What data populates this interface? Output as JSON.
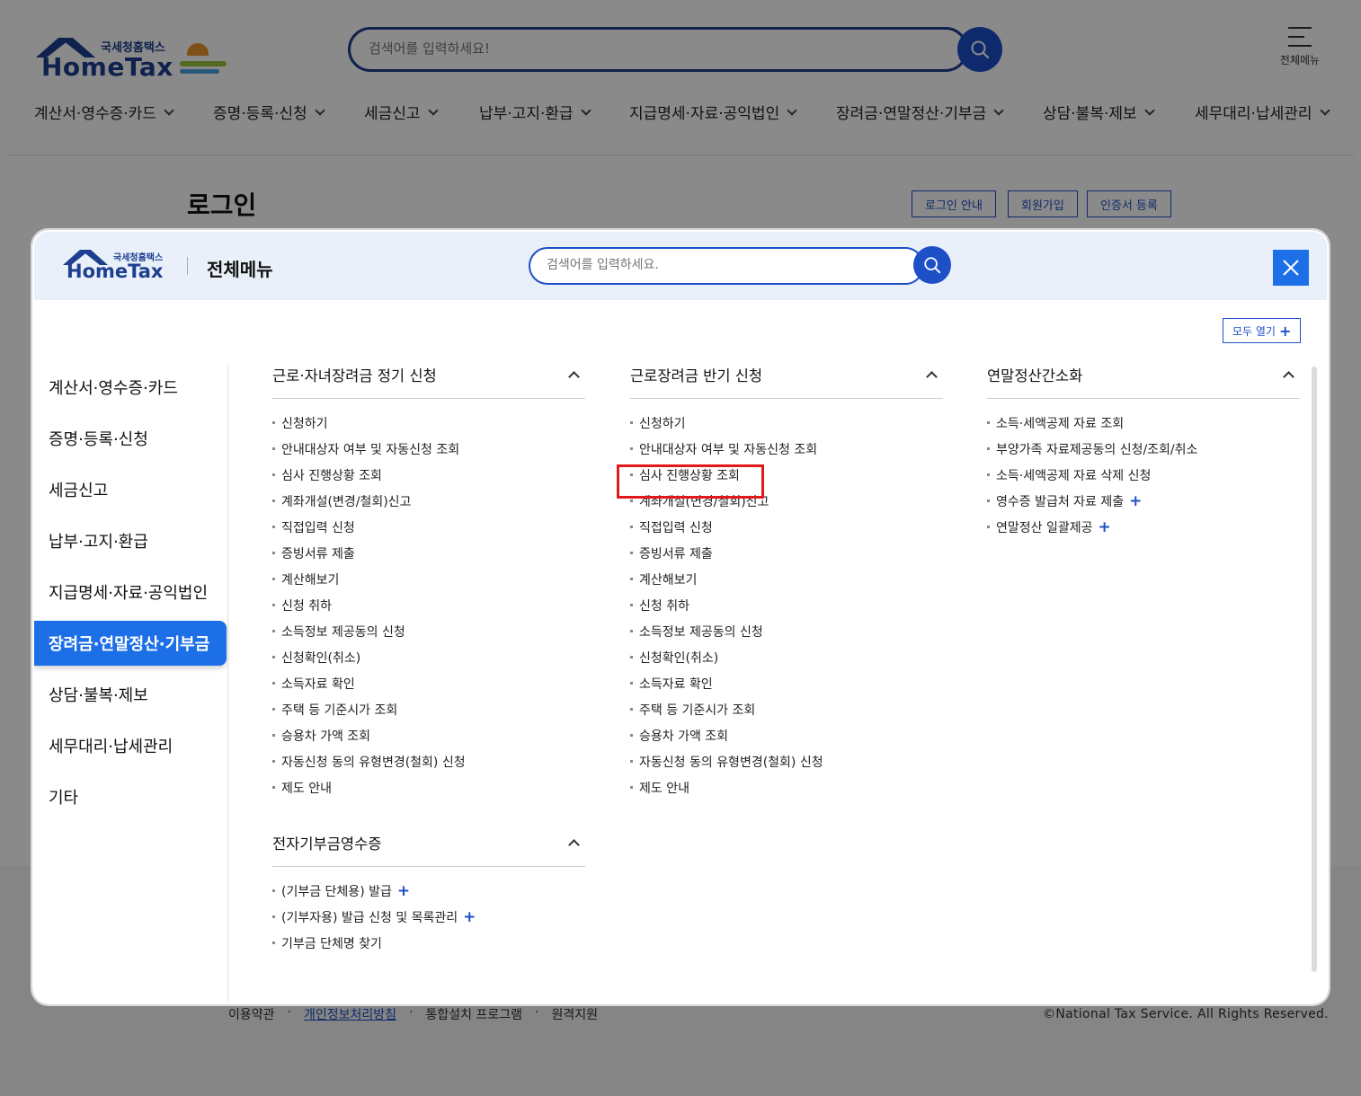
{
  "header": {
    "logo_kor": "국세청홈택스",
    "logo_eng": "HomeTax",
    "search_placeholder": "검색어를 입력하세요!",
    "allmenu_label": "전체메뉴",
    "gnb": [
      "계산서·영수증·카드",
      "증명·등록·신청",
      "세금신고",
      "납부·고지·환급",
      "지급명세·자료·공익법인",
      "장려금·연말정산·기부금",
      "상담·불복·제보",
      "세무대리·납세관리"
    ]
  },
  "page": {
    "title": "로그인",
    "buttons": [
      "로그인 안내",
      "회원가입",
      "인증서 등록"
    ]
  },
  "footer": {
    "links": [
      "이용약관",
      "개인정보처리방침",
      "통합설치 프로그램",
      "원격지원"
    ],
    "separator": "·",
    "copyright": "©National Tax Service. All Rights Reserved."
  },
  "modal": {
    "logo_kor": "국세청홈택스",
    "logo_eng": "HomeTax",
    "title": "전체메뉴",
    "search_placeholder": "검색어를 입력하세요.",
    "open_all_label": "모두 열기",
    "side_items": [
      "계산서·영수증·카드",
      "증명·등록·신청",
      "세금신고",
      "납부·고지·환급",
      "지급명세·자료·공익법인",
      "장려금·연말정산·기부금",
      "상담·불복·제보",
      "세무대리·납세관리",
      "기타"
    ],
    "active_side_index": 5,
    "columns": [
      {
        "title": "근로·자녀장려금 정기 신청",
        "items": [
          "신청하기",
          "안내대상자 여부 및 자동신청 조회",
          "심사 진행상황 조회",
          "계좌개설(변경/철회)신고",
          "직접입력 신청",
          "증빙서류 제출",
          "계산해보기",
          "신청 취하",
          "소득정보 제공동의 신청",
          "신청확인(취소)",
          "소득자료 확인",
          "주택 등 기준시가 조회",
          "승용차 가액 조회",
          "자동신청 동의 유형변경(철회) 신청",
          "제도 안내"
        ]
      },
      {
        "title": "근로장려금 반기 신청",
        "items": [
          "신청하기",
          "안내대상자 여부 및 자동신청 조회",
          "심사 진행상황 조회",
          "계좌개설(변경/철회)신고",
          "직접입력 신청",
          "증빙서류 제출",
          "계산해보기",
          "신청 취하",
          "소득정보 제공동의 신청",
          "신청확인(취소)",
          "소득자료 확인",
          "주택 등 기준시가 조회",
          "승용차 가액 조회",
          "자동신청 동의 유형변경(철회) 신청",
          "제도 안내"
        ]
      },
      {
        "title": "연말정산간소화",
        "items": [
          "소득·세액공제 자료 조회",
          "부양가족 자료제공동의 신청/조회/취소",
          "소득·세액공제 자료 삭제 신청",
          "영수증 발급처 자료 제출",
          "연말정산 일괄제공"
        ]
      },
      {
        "title": "전자기부금영수증",
        "items": [
          "(기부금 단체용) 발급",
          "(기부자용) 발급 신청 및 목록관리",
          "기부금 단체명 찾기"
        ]
      }
    ]
  }
}
